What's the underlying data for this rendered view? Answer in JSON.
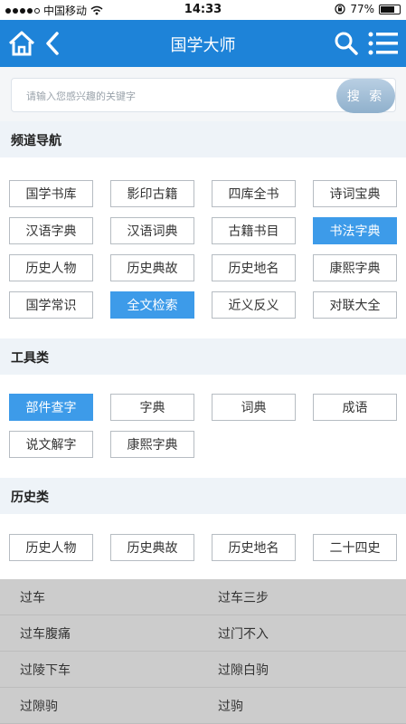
{
  "status_bar": {
    "carrier": "中国移动",
    "time": "14:33",
    "battery": "77%"
  },
  "nav": {
    "title": "国学大师"
  },
  "search": {
    "placeholder": "请输入您感兴趣的关键字",
    "button_label": "搜 索"
  },
  "sections": {
    "channel": {
      "title": "频道导航",
      "items": [
        {
          "label": "国学书库",
          "active": false
        },
        {
          "label": "影印古籍",
          "active": false
        },
        {
          "label": "四库全书",
          "active": false
        },
        {
          "label": "诗词宝典",
          "active": false
        },
        {
          "label": "汉语字典",
          "active": false
        },
        {
          "label": "汉语词典",
          "active": false
        },
        {
          "label": "古籍书目",
          "active": false
        },
        {
          "label": "书法字典",
          "active": true
        },
        {
          "label": "历史人物",
          "active": false
        },
        {
          "label": "历史典故",
          "active": false
        },
        {
          "label": "历史地名",
          "active": false
        },
        {
          "label": "康熙字典",
          "active": false
        },
        {
          "label": "国学常识",
          "active": false
        },
        {
          "label": "全文检索",
          "active": true
        },
        {
          "label": "近义反义",
          "active": false
        },
        {
          "label": "对联大全",
          "active": false
        }
      ]
    },
    "tools": {
      "title": "工具类",
      "items": [
        {
          "label": "部件查字",
          "active": true
        },
        {
          "label": "字典",
          "active": false
        },
        {
          "label": "词典",
          "active": false
        },
        {
          "label": "成语",
          "active": false
        },
        {
          "label": "说文解字",
          "active": false
        },
        {
          "label": "康熙字典",
          "active": false
        }
      ]
    },
    "history": {
      "title": "历史类",
      "items": [
        {
          "label": "历史人物",
          "active": false
        },
        {
          "label": "历史典故",
          "active": false
        },
        {
          "label": "历史地名",
          "active": false
        },
        {
          "label": "二十四史",
          "active": false
        }
      ]
    }
  },
  "suggestions": [
    [
      "过车",
      "过车三步"
    ],
    [
      "过车腹痛",
      "过门不入"
    ],
    [
      "过陵下车",
      "过隙白驹"
    ],
    [
      "过隙驹",
      "过驹"
    ]
  ]
}
